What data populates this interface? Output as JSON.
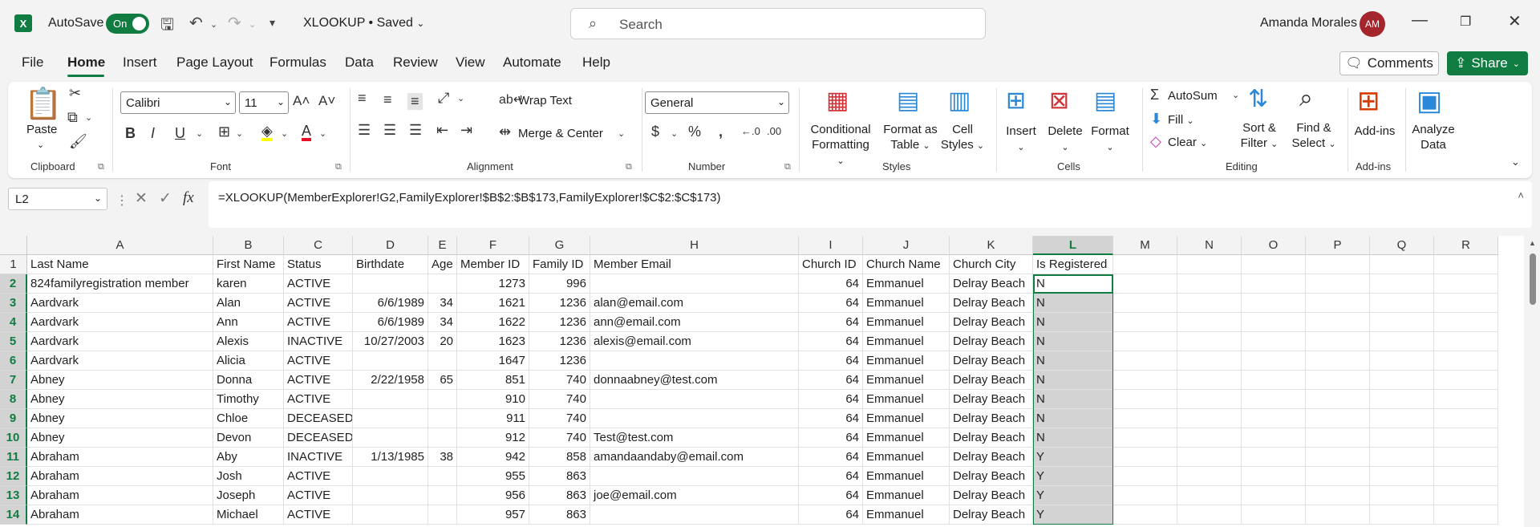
{
  "titlebar": {
    "app_icon": "X",
    "autosave_label": "AutoSave",
    "autosave_state": "On",
    "doc_title": "XLOOKUP • Saved",
    "search_placeholder": "Search",
    "user_name": "Amanda Morales",
    "user_initials": "AM"
  },
  "menu": {
    "items": [
      "File",
      "Home",
      "Insert",
      "Page Layout",
      "Formulas",
      "Data",
      "Review",
      "View",
      "Automate",
      "Help"
    ],
    "active": "Home",
    "comments": "Comments",
    "share": "Share"
  },
  "ribbon": {
    "clipboard": {
      "paste": "Paste",
      "label": "Clipboard"
    },
    "font": {
      "name": "Calibri",
      "size": "11",
      "label": "Font"
    },
    "alignment": {
      "wrap": "Wrap Text",
      "merge": "Merge & Center",
      "label": "Alignment"
    },
    "number": {
      "format": "General",
      "label": "Number"
    },
    "styles": {
      "conditional": [
        "Conditional",
        "Formatting"
      ],
      "format_table": [
        "Format as",
        "Table"
      ],
      "cell_styles": [
        "Cell",
        "Styles"
      ],
      "label": "Styles"
    },
    "cells": {
      "insert": "Insert",
      "delete": "Delete",
      "format": "Format",
      "label": "Cells"
    },
    "editing": {
      "autosum": "AutoSum",
      "fill": "Fill",
      "clear": "Clear",
      "sort": [
        "Sort &",
        "Filter"
      ],
      "find": [
        "Find &",
        "Select"
      ],
      "label": "Editing"
    },
    "addins": {
      "btn": "Add-ins",
      "label": "Add-ins"
    },
    "analyze": {
      "btn": [
        "Analyze",
        "Data"
      ]
    }
  },
  "formula_bar": {
    "name_box": "L2",
    "formula": "=XLOOKUP(MemberExplorer!G2,FamilyExplorer!$B$2:$B$173,FamilyExplorer!$C$2:$C$173)"
  },
  "sheet": {
    "columns": [
      "A",
      "B",
      "C",
      "D",
      "E",
      "F",
      "G",
      "H",
      "I",
      "J",
      "K",
      "L",
      "M",
      "N",
      "O",
      "P",
      "Q",
      "R"
    ],
    "selected_column": "L",
    "rows": [
      [
        "Last Name",
        "First Name",
        "Status",
        "Birthdate",
        "Age",
        "Member ID",
        "Family ID",
        "Member Email",
        "Church ID",
        "Church Name",
        "Church City",
        "Is Registered"
      ],
      [
        "824familyregistration member",
        "karen",
        "ACTIVE",
        "",
        "",
        "1273",
        "996",
        "",
        "64",
        "Emmanuel",
        "Delray Beach",
        "N"
      ],
      [
        "Aardvark",
        "Alan",
        "ACTIVE",
        "6/6/1989",
        "34",
        "1621",
        "1236",
        "alan@email.com",
        "64",
        "Emmanuel",
        "Delray Beach",
        "N"
      ],
      [
        "Aardvark",
        "Ann",
        "ACTIVE",
        "6/6/1989",
        "34",
        "1622",
        "1236",
        "ann@email.com",
        "64",
        "Emmanuel",
        "Delray Beach",
        "N"
      ],
      [
        "Aardvark",
        "Alexis",
        "INACTIVE",
        "10/27/2003",
        "20",
        "1623",
        "1236",
        "alexis@email.com",
        "64",
        "Emmanuel",
        "Delray Beach",
        "N"
      ],
      [
        "Aardvark",
        "Alicia",
        "ACTIVE",
        "",
        "",
        "1647",
        "1236",
        "",
        "64",
        "Emmanuel",
        "Delray Beach",
        "N"
      ],
      [
        "Abney",
        "Donna",
        "ACTIVE",
        "2/22/1958",
        "65",
        "851",
        "740",
        "donnaabney@test.com",
        "64",
        "Emmanuel",
        "Delray Beach",
        "N"
      ],
      [
        "Abney",
        "Timothy",
        "ACTIVE",
        "",
        "",
        "910",
        "740",
        "",
        "64",
        "Emmanuel",
        "Delray Beach",
        "N"
      ],
      [
        "Abney",
        "Chloe",
        "DECEASED",
        "",
        "",
        "911",
        "740",
        "",
        "64",
        "Emmanuel",
        "Delray Beach",
        "N"
      ],
      [
        "Abney",
        "Devon",
        "DECEASED",
        "",
        "",
        "912",
        "740",
        "Test@test.com",
        "64",
        "Emmanuel",
        "Delray Beach",
        "N"
      ],
      [
        "Abraham",
        "Aby",
        "INACTIVE",
        "1/13/1985",
        "38",
        "942",
        "858",
        "amandaandaby@email.com",
        "64",
        "Emmanuel",
        "Delray Beach",
        "Y"
      ],
      [
        "Abraham",
        "Josh",
        "ACTIVE",
        "",
        "",
        "955",
        "863",
        "",
        "64",
        "Emmanuel",
        "Delray Beach",
        "Y"
      ],
      [
        "Abraham",
        "Joseph",
        "ACTIVE",
        "",
        "",
        "956",
        "863",
        "joe@email.com",
        "64",
        "Emmanuel",
        "Delray Beach",
        "Y"
      ],
      [
        "Abraham",
        "Michael",
        "ACTIVE",
        "",
        "",
        "957",
        "863",
        "",
        "64",
        "Emmanuel",
        "Delray Beach",
        "Y"
      ]
    ]
  }
}
